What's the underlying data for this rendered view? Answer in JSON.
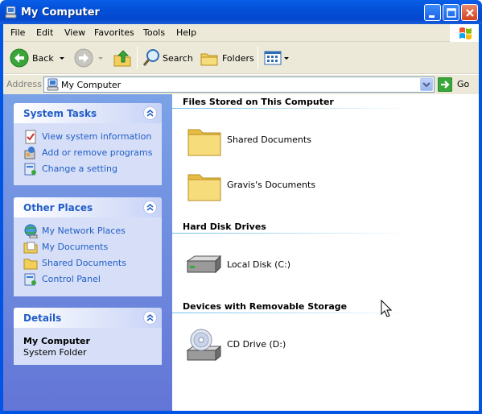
{
  "window": {
    "title": "My Computer"
  },
  "menu": {
    "items": [
      "File",
      "Edit",
      "View",
      "Favorites",
      "Tools",
      "Help"
    ]
  },
  "toolbar": {
    "back_label": "Back",
    "search_label": "Search",
    "folders_label": "Folders"
  },
  "address": {
    "label": "Address",
    "value": "My Computer",
    "go_label": "Go"
  },
  "sidebar": {
    "system_tasks": {
      "title": "System Tasks",
      "items": [
        "View system information",
        "Add or remove programs",
        "Change a setting"
      ]
    },
    "other_places": {
      "title": "Other Places",
      "items": [
        "My Network Places",
        "My Documents",
        "Shared Documents",
        "Control Panel"
      ]
    },
    "details": {
      "title": "Details",
      "name": "My Computer",
      "type": "System Folder"
    }
  },
  "content": {
    "groups": [
      {
        "title": "Files Stored on This Computer",
        "items": [
          "Shared Documents",
          "Gravis's Documents"
        ]
      },
      {
        "title": "Hard Disk Drives",
        "items": [
          "Local Disk (C:)"
        ]
      },
      {
        "title": "Devices with Removable Storage",
        "items": [
          "CD Drive (D:)"
        ]
      }
    ]
  },
  "colors": {
    "titlebar": "#0450d8",
    "task_pane": "#6375d6",
    "link": "#215dc6",
    "menu_bg": "#ece9d8"
  }
}
